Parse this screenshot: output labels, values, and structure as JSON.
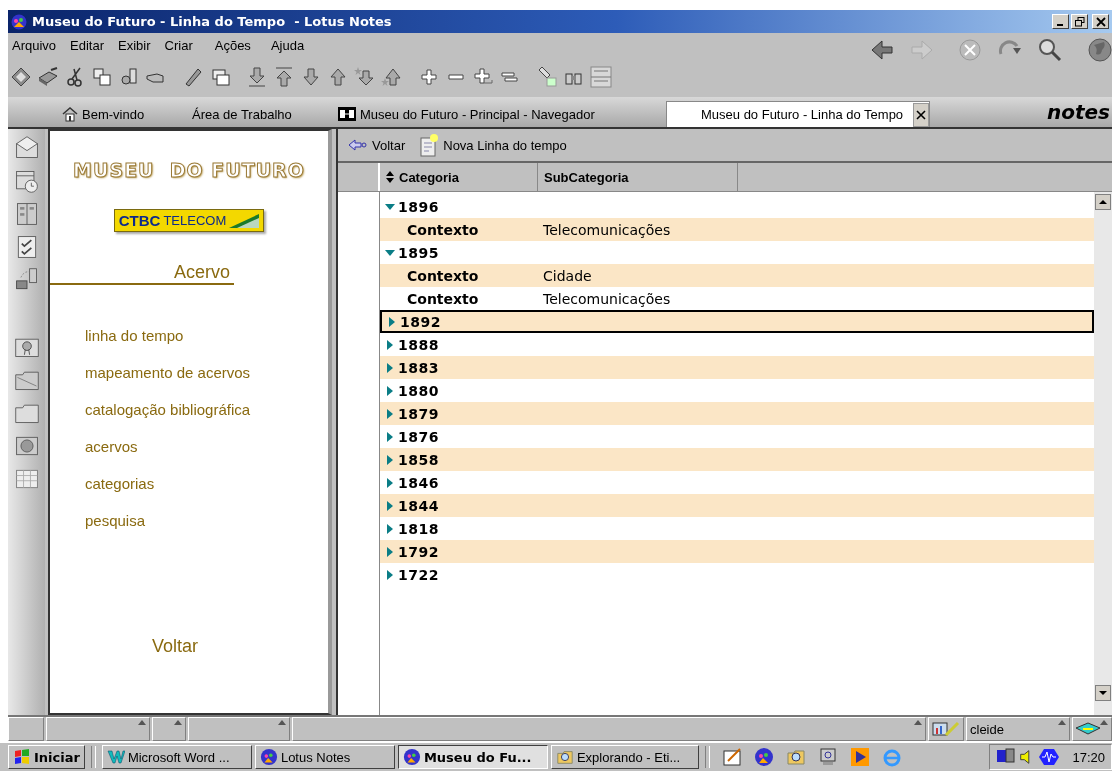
{
  "window": {
    "title": "Museu do Futuro - Linha do Tempo  - Lotus Notes"
  },
  "menu": [
    "Arquivo",
    "Editar",
    "Exibir",
    "Criar",
    "Ações",
    "Ajuda"
  ],
  "tabs": [
    {
      "label": "Bem-vindo",
      "selected": false
    },
    {
      "label": "Área de Trabalho",
      "selected": false
    },
    {
      "label": "Museu do Futuro - Principal - Navegador",
      "selected": false
    },
    {
      "label": "Museu do Futuro - Linha do Tempo",
      "selected": true
    }
  ],
  "brand": "notes",
  "nav": {
    "title": "MUSEU  DO FUTURO",
    "sponsor": {
      "brand": "CTBC",
      "suffix": "TELECOM"
    },
    "section": "Acervo",
    "links": [
      "linha do tempo",
      "mapeamento de acervos",
      "catalogação bibliográfica",
      "acervos",
      "categorias",
      "pesquisa"
    ],
    "back": "Voltar"
  },
  "actions": [
    "Voltar",
    "Nova Linha do tempo"
  ],
  "columns": [
    "Categoria",
    "SubCategoria"
  ],
  "rows": [
    {
      "label": "1896",
      "expanded": true,
      "selected": false,
      "children": [
        {
          "category": "Contexto",
          "subcategory": "Telecomunicações",
          "selected": false
        }
      ]
    },
    {
      "label": "1895",
      "expanded": true,
      "selected": false,
      "children": [
        {
          "category": "Contexto",
          "subcategory": "Cidade",
          "selected": false
        },
        {
          "category": "Contexto",
          "subcategory": "Telecomunicações",
          "selected": false
        }
      ]
    },
    {
      "label": "1892",
      "expanded": false,
      "selected": true
    },
    {
      "label": "1888",
      "expanded": false,
      "selected": false
    },
    {
      "label": "1883",
      "expanded": false,
      "selected": false
    },
    {
      "label": "1880",
      "expanded": false,
      "selected": false
    },
    {
      "label": "1879",
      "expanded": false,
      "selected": false
    },
    {
      "label": "1876",
      "expanded": false,
      "selected": false
    },
    {
      "label": "1858",
      "expanded": false,
      "selected": false
    },
    {
      "label": "1846",
      "expanded": false,
      "selected": false
    },
    {
      "label": "1844",
      "expanded": false,
      "selected": false
    },
    {
      "label": "1818",
      "expanded": false,
      "selected": false
    },
    {
      "label": "1792",
      "expanded": false,
      "selected": false
    },
    {
      "label": "1722",
      "expanded": false,
      "selected": false
    }
  ],
  "status_bar": {
    "user": "cleide"
  },
  "taskbar": {
    "start": "Iniciar",
    "tasks": [
      {
        "label": "Microsoft Word ...",
        "selected": false
      },
      {
        "label": "Lotus Notes",
        "selected": false
      },
      {
        "label": "Museu do Fu...",
        "selected": true
      },
      {
        "label": "Explorando - Eti...",
        "selected": false
      }
    ],
    "clock": "17:20"
  }
}
